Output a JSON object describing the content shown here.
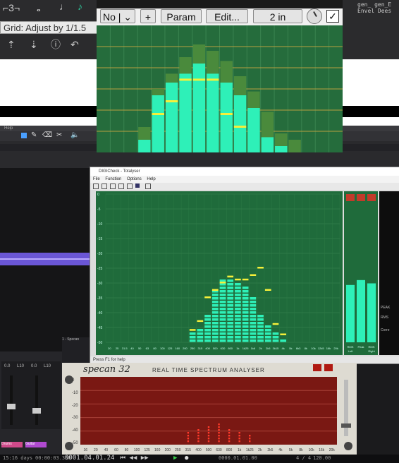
{
  "colors": {
    "plugin_bg": "#256c3c",
    "bar_cyan": "#2ef0b8",
    "bar_peak": "#f6f03a",
    "specan_red": "#7a1813",
    "specan_dot": "#ff3a2a"
  },
  "daw": {
    "tooltip": "Grid: Adjust by 1/1.5",
    "right_labels": [
      "gen_",
      "gen_E",
      "Envel",
      "Dees"
    ],
    "statusbar": {
      "days": "15:16 days",
      "time": "00:00:03.350",
      "position": "0001.04.01.24",
      "pos2": "0000.01.01.00",
      "sig": "4 / 4",
      "tempo": "120.00"
    },
    "mixer": {
      "channels": [
        "1 - Specan",
        "Drums",
        "Guitar"
      ],
      "values": [
        "0.0",
        "L10",
        "0.0",
        "L10"
      ]
    },
    "tracks_label": "Help"
  },
  "plugin": {
    "preset_select": "No |",
    "plus_label": "+",
    "param_label": "Param",
    "edit_label": "Edit...",
    "in_label": "2 in",
    "levels": [
      0.0,
      0.0,
      0.0,
      0.1,
      0.45,
      0.55,
      0.62,
      0.7,
      0.62,
      0.55,
      0.45,
      0.35,
      0.12,
      0.05,
      0,
      0,
      0,
      0
    ],
    "ghost_levels": [
      0.0,
      0.0,
      0.0,
      0.2,
      0.5,
      0.62,
      0.75,
      0.85,
      0.8,
      0.72,
      0.6,
      0.48,
      0.32,
      0.15,
      0.1,
      0,
      0,
      0
    ],
    "peak_levels": [
      0,
      0,
      0,
      0,
      0.3,
      0.4,
      0.57,
      0.57,
      0.57,
      0.3,
      0.2,
      0,
      0,
      0,
      0,
      0,
      0,
      0
    ]
  },
  "digicheck": {
    "title": "DIGICheck - Totalyser",
    "menu": [
      "File",
      "Function",
      "Options",
      "Help"
    ],
    "status": "Press F1 for help",
    "y_labels": [
      "0",
      "-5",
      "-10",
      "-15",
      "-20",
      "-25",
      "-30",
      "-35",
      "-40",
      "-45",
      "-50"
    ],
    "x_labels": [
      "20",
      "25",
      "31.5",
      "40",
      "50",
      "63",
      "80",
      "100",
      "125",
      "160",
      "200",
      "250",
      "315",
      "400",
      "500",
      "630",
      "800",
      "1k",
      "1k25",
      "1k6",
      "2k",
      "2k5",
      "3k15",
      "4k",
      "5k",
      "6k3",
      "8k",
      "10k",
      "12k5",
      "16k",
      "20k"
    ],
    "levels": [
      0,
      0,
      0,
      0,
      0,
      0,
      0,
      0,
      0,
      0,
      0,
      0.07,
      0.1,
      0.2,
      0.36,
      0.42,
      0.44,
      0.4,
      0.38,
      0.3,
      0.2,
      0.12,
      0.06,
      0.03,
      0,
      0,
      0,
      0,
      0,
      0,
      0
    ],
    "peaks": [
      0,
      0,
      0,
      0,
      0,
      0,
      0,
      0,
      0,
      0,
      0,
      0.08,
      0.14,
      0.3,
      0.35,
      0.4,
      0.44,
      0.42,
      0.42,
      0.45,
      0.5,
      0.35,
      0.12,
      0.05,
      0,
      0,
      0,
      0,
      0,
      0,
      0
    ],
    "meter_labels": [
      "RMS",
      "Peak",
      "RMS"
    ],
    "meter_sub": [
      "Left",
      "",
      "Right"
    ],
    "side_labels": [
      "PEAK",
      "RMS",
      "Corre"
    ]
  },
  "specan": {
    "logo": "specan 32",
    "title": "REAL   TIME   SPECTRUM   ANALYSER",
    "left_labels": [
      "0",
      "-10",
      "-20",
      "-30",
      "-40",
      "-50"
    ],
    "x_labels": [
      "16",
      "20",
      "40",
      "60",
      "80",
      "100",
      "125",
      "160",
      "200",
      "250",
      "315",
      "400",
      "500",
      "630",
      "800",
      "1k",
      "1k25",
      "2k",
      "2k5",
      "4k",
      "5k",
      "8k",
      "10k",
      "16k",
      "20k"
    ],
    "dots": [
      0,
      0,
      0,
      0,
      0,
      0,
      0,
      0,
      0,
      0,
      0.15,
      0.2,
      0.25,
      0.28,
      0.22,
      0.18,
      0.12,
      0,
      0,
      0,
      0,
      0,
      0,
      0,
      0
    ]
  }
}
